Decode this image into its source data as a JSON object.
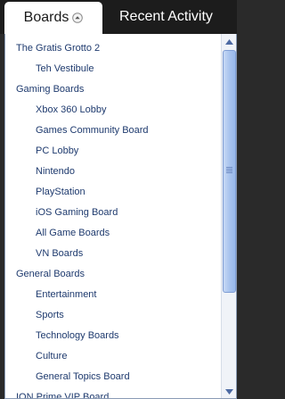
{
  "tabs": {
    "boards_label": "Boards",
    "boards_icon": "collapse-up-icon",
    "recent_label": "Recent Activity"
  },
  "colors": {
    "link": "#1e3a6e",
    "topbar": "#1c1c1c",
    "scroll_thumb": "#a9c4ee"
  },
  "boards_list": [
    {
      "label": "The Gratis Grotto 2",
      "level": 0
    },
    {
      "label": "Teh Vestibule",
      "level": 1
    },
    {
      "label": "Gaming Boards",
      "level": 0
    },
    {
      "label": "Xbox 360 Lobby",
      "level": 1
    },
    {
      "label": "Games Community Board",
      "level": 1
    },
    {
      "label": "PC Lobby",
      "level": 1
    },
    {
      "label": "Nintendo",
      "level": 1
    },
    {
      "label": "PlayStation",
      "level": 1
    },
    {
      "label": "iOS Gaming Board",
      "level": 1
    },
    {
      "label": "All Game Boards",
      "level": 1
    },
    {
      "label": "VN Boards",
      "level": 1
    },
    {
      "label": "General Boards",
      "level": 0
    },
    {
      "label": "Entertainment",
      "level": 1
    },
    {
      "label": "Sports",
      "level": 1
    },
    {
      "label": "Technology Boards",
      "level": 1
    },
    {
      "label": "Culture",
      "level": 1
    },
    {
      "label": "General Topics Board",
      "level": 1
    },
    {
      "label": "ION Prime VIP Board",
      "level": 0
    }
  ]
}
